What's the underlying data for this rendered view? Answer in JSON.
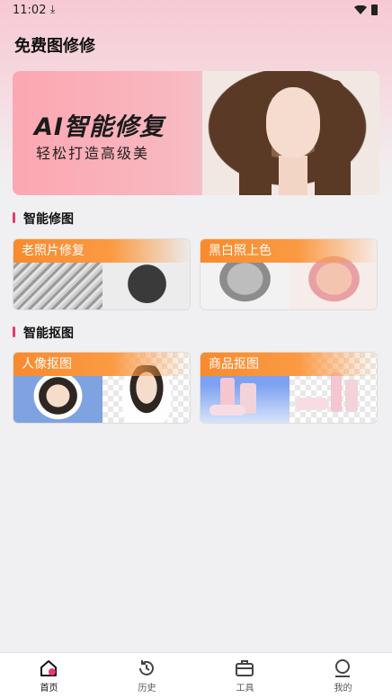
{
  "status_bar": {
    "time": "11:02",
    "download_icon": "download-icon",
    "wifi_icon": "wifi-icon",
    "battery_icon": "battery-icon"
  },
  "app": {
    "title": "免费图修修"
  },
  "banner": {
    "title": "AI智能修复",
    "subtitle": "轻松打造高级美"
  },
  "sections": [
    {
      "title": "智能修图",
      "cards": [
        {
          "label": "老照片修复"
        },
        {
          "label": "黑白照上色"
        }
      ]
    },
    {
      "title": "智能抠图",
      "cards": [
        {
          "label": "人像抠图"
        },
        {
          "label": "商品抠图"
        }
      ]
    }
  ],
  "nav": {
    "items": [
      {
        "label": "首页",
        "icon": "home-icon",
        "active": true
      },
      {
        "label": "历史",
        "icon": "history-icon",
        "active": false
      },
      {
        "label": "工具",
        "icon": "toolbox-icon",
        "active": false
      },
      {
        "label": "我的",
        "icon": "profile-icon",
        "active": false
      }
    ]
  },
  "colors": {
    "accent": "#e6396a",
    "tag_orange": "#f98a2e",
    "banner_pink": "#fca7b1"
  }
}
